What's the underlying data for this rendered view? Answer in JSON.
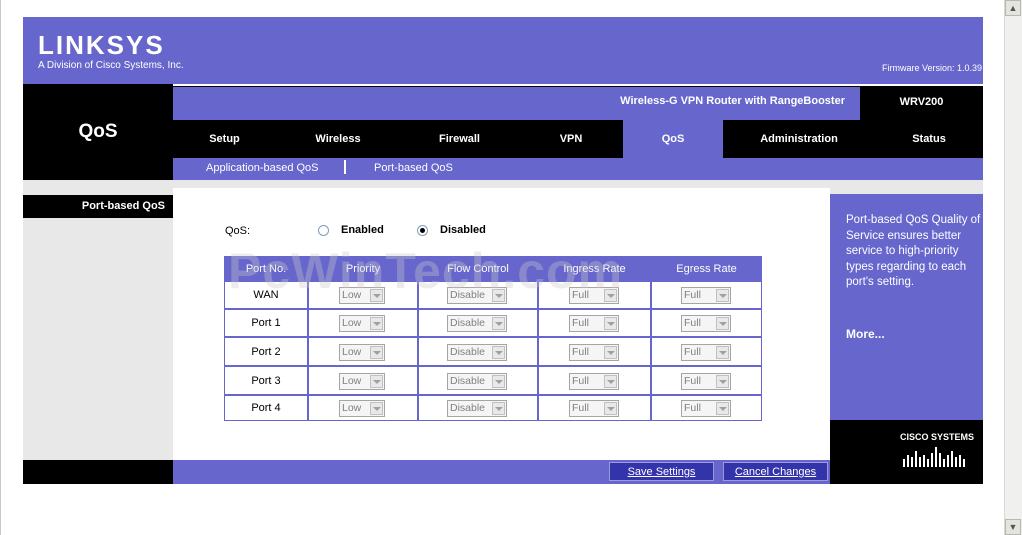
{
  "brand": {
    "logo": "LINKSYS",
    "tagline": "A Division of Cisco Systems, Inc.",
    "firmware": "Firmware Version: 1.0.39",
    "product_name": "Wireless-G VPN Router with RangeBooster",
    "model": "WRV200",
    "section_title": "QoS",
    "cisco_logo": "Cisco Systems"
  },
  "tabs": [
    "Setup",
    "Wireless",
    "Firewall",
    "VPN",
    "QoS",
    "Administration",
    "Status"
  ],
  "active_tab": "QoS",
  "subnav": [
    "Application-based QoS",
    "Port-based QoS"
  ],
  "sidebar": {
    "label": "Port-based QoS"
  },
  "qos": {
    "label": "QoS:",
    "options": [
      "Enabled",
      "Disabled"
    ],
    "selected": "Disabled"
  },
  "table": {
    "headers": [
      "Port No.",
      "Priority",
      "Flow Control",
      "Ingress Rate",
      "Egress Rate"
    ],
    "rows": [
      {
        "port": "WAN",
        "priority": "Low",
        "flow": "Disable",
        "ingress": "Full",
        "egress": "Full"
      },
      {
        "port": "Port 1",
        "priority": "Low",
        "flow": "Disable",
        "ingress": "Full",
        "egress": "Full"
      },
      {
        "port": "Port 2",
        "priority": "Low",
        "flow": "Disable",
        "ingress": "Full",
        "egress": "Full"
      },
      {
        "port": "Port 3",
        "priority": "Low",
        "flow": "Disable",
        "ingress": "Full",
        "egress": "Full"
      },
      {
        "port": "Port 4",
        "priority": "Low",
        "flow": "Disable",
        "ingress": "Full",
        "egress": "Full"
      }
    ]
  },
  "help": {
    "text": "Port-based QoS Quality of Service ensures better service to high-priority types regarding to each port's setting.",
    "more": "More..."
  },
  "buttons": {
    "save": "Save Settings",
    "cancel": "Cancel Changes"
  },
  "watermark": "PcWinTech.com",
  "colors": {
    "brand_purple": "#6666cc",
    "black": "#000000",
    "gray_panel": "#e8e8e8"
  }
}
